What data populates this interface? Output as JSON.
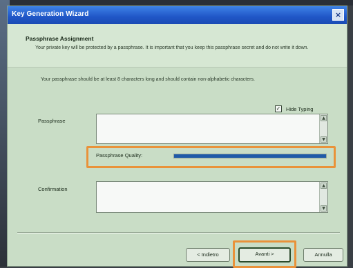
{
  "window": {
    "title": "Key Generation Wizard",
    "close_glyph": "×"
  },
  "header": {
    "title": "Passphrase Assignment",
    "description": "Your private key will be protected by a passphrase. It is important that you keep this passphrase secret and do not write it down."
  },
  "body": {
    "description": "Your passphrase should be at least 8 characters long and should contain non-alphabetic characters.",
    "hide_typing_label": "Hide Typing",
    "hide_typing_checked": true,
    "passphrase_label": "Passphrase",
    "passphrase_value": "",
    "quality_label": "Passphrase Quality:",
    "quality_fraction": 1.0,
    "confirmation_label": "Confirmation",
    "confirmation_value": ""
  },
  "buttons": {
    "back_label": "< Indietro",
    "next_label": "Avanti >",
    "cancel_label": "Annulla"
  },
  "colors": {
    "titlebar": "#2056c7",
    "dialog_bg": "#c9ddc6",
    "highlight": "#e9923a",
    "quality_bar": "#1f5aa8"
  }
}
